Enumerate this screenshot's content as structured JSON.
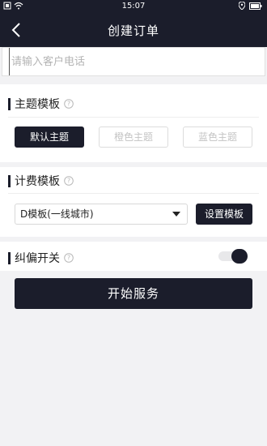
{
  "status_bar": {
    "time": "15:07"
  },
  "nav": {
    "title": "创建订单"
  },
  "phone_input": {
    "placeholder": "请输入客户电话",
    "value": ""
  },
  "theme_section": {
    "title": "主题模板",
    "options": [
      "默认主题",
      "橙色主题",
      "蓝色主题"
    ],
    "selected": "默认主题"
  },
  "billing_section": {
    "title": "计费模板",
    "selected_template": "D模板(一线城市)",
    "set_button": "设置模板"
  },
  "correction_section": {
    "title": "纠偏开关",
    "enabled": true
  },
  "start_button": "开始服务",
  "colors": {
    "primary": "#1b1d2b",
    "background": "#f2f2f4"
  }
}
